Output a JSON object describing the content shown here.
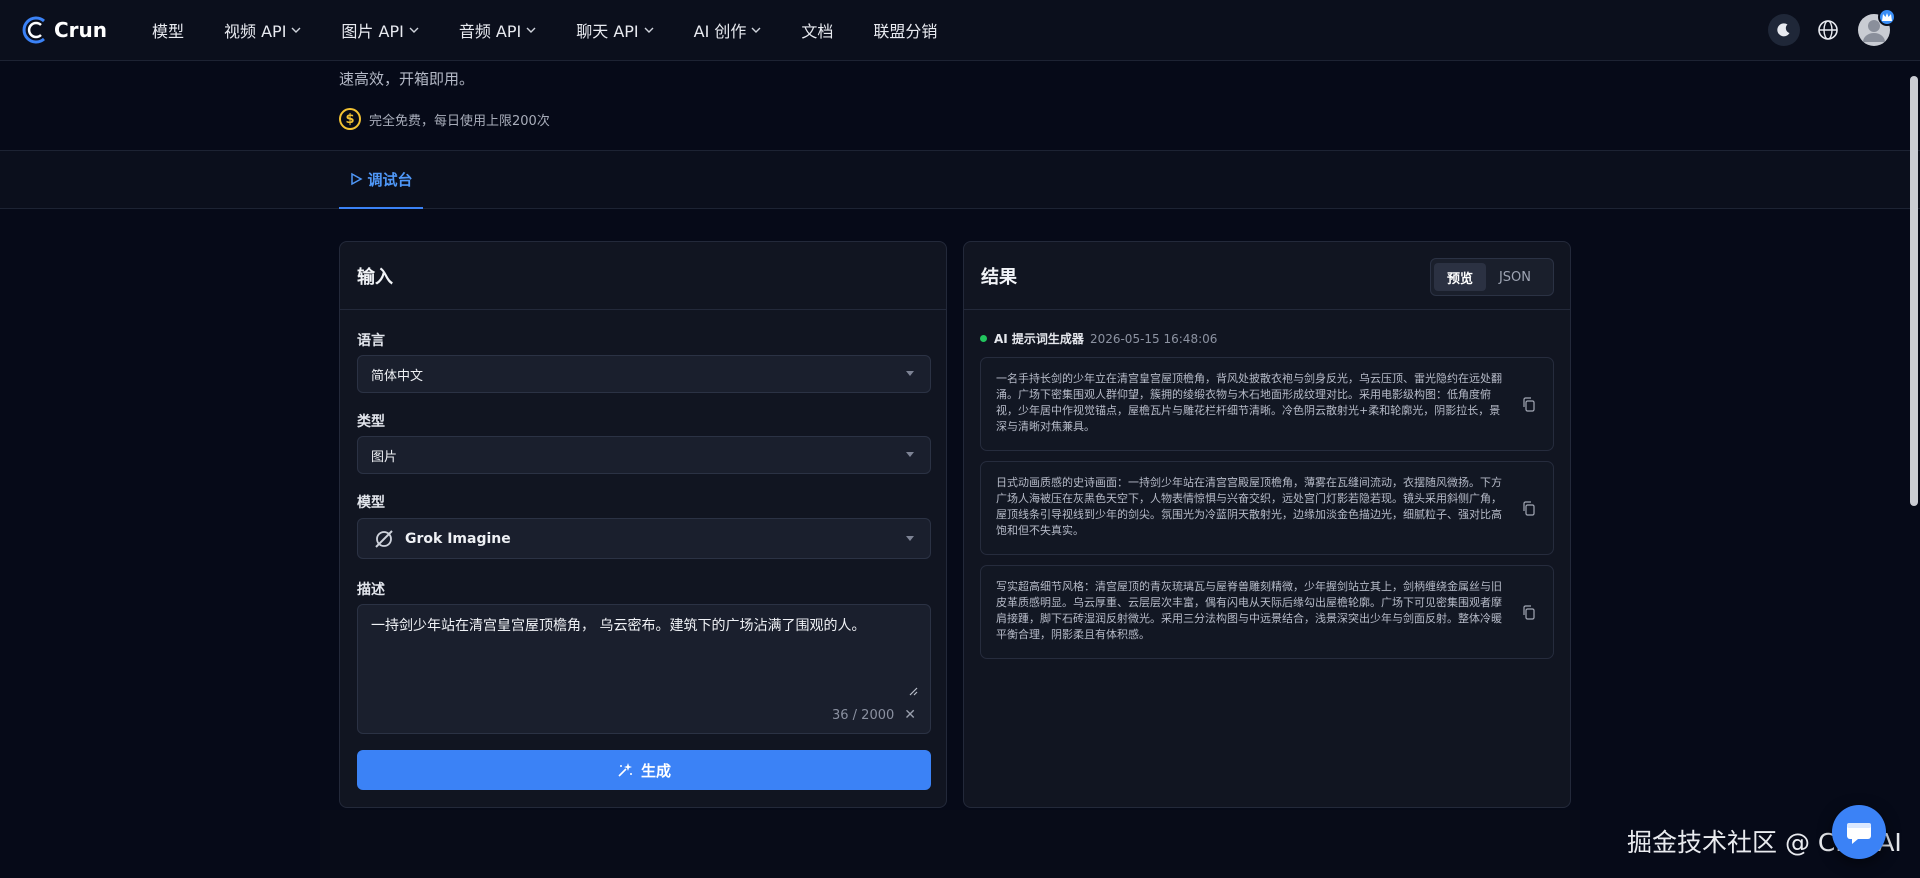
{
  "nav": {
    "logo_text": "Crun",
    "items": [
      {
        "label": "模型",
        "dropdown": false
      },
      {
        "label": "视频 API",
        "dropdown": true
      },
      {
        "label": "图片 API",
        "dropdown": true
      },
      {
        "label": "音频 API",
        "dropdown": true
      },
      {
        "label": "聊天 API",
        "dropdown": true
      },
      {
        "label": "AI 创作",
        "dropdown": true
      },
      {
        "label": "文档",
        "dropdown": false
      },
      {
        "label": "联盟分销",
        "dropdown": false
      }
    ],
    "icons": [
      "moon-icon",
      "globe-icon",
      "user-avatar"
    ]
  },
  "hero": {
    "description": "速高效，开箱即用。",
    "free_note": "完全免费，每日使用上限200次",
    "coin_symbol": "$"
  },
  "tabs": [
    {
      "label": "调试台",
      "active": true
    }
  ],
  "input_panel": {
    "title": "输入",
    "language_label": "语言",
    "language_value": "简体中文",
    "type_label": "类型",
    "type_value": "图片",
    "model_label": "模型",
    "model_value": "Grok Imagine",
    "desc_label": "描述",
    "desc_value": "一持剑少年站在清宫皇宫屋顶檐角， 乌云密布。建筑下的广场沾满了围观的人。",
    "counter": "36 / 2000",
    "clear_symbol": "✕",
    "generate_label": "生成"
  },
  "result_panel": {
    "title": "结果",
    "view_preview": "预览",
    "view_json": "JSON",
    "generator_name": "AI 提示词生成器",
    "timestamp": "2026-05-15 16:48:06",
    "results": [
      {
        "text": "一名手持长剑的少年立在清宫皇宫屋顶檐角，背风处披散衣袍与剑身反光，乌云压顶、雷光隐约在远处翻涌。广场下密集围观人群仰望，簇拥的绫缎衣物与木石地面形成纹理对比。采用电影级构图：低角度俯视，少年居中作视觉锚点，屋檐瓦片与雕花栏杆细节清晰。冷色阴云散射光+柔和轮廓光，阴影拉长，景深与清晰对焦兼具。"
      },
      {
        "text": "日式动画质感的史诗画面：一持剑少年站在清宫宫殿屋顶檐角，薄雾在瓦缝间流动，衣摆随风微扬。下方广场人海被压在灰黑色天空下，人物表情惊惧与兴奋交织，远处宫门灯影若隐若现。镜头采用斜侧广角，屋顶线条引导视线到少年的剑尖。氛围光为冷蓝阴天散射光，边缘加淡金色描边光，细腻粒子、强对比高饱和但不失真实。"
      },
      {
        "text": "写实超高细节风格：清宫屋顶的青灰琉璃瓦与屋脊兽雕刻精微，少年握剑站立其上，剑柄缠绕金属丝与旧皮革质感明显。乌云厚重、云层层次丰富，偶有闪电从天际后缘勾出屋檐轮廓。广场下可见密集围观者摩肩接踵，脚下石砖湿润反射微光。采用三分法构图与中远景结合，浅景深突出少年与剑面反射。整体冷暖平衡合理，阴影柔且有体积感。"
      }
    ]
  },
  "watermark": "掘金技术社区 @ CrunAI",
  "colors": {
    "accent": "#3b82f6",
    "background": "#060a18",
    "panel": "#111521",
    "status_green": "#22c55e",
    "coin_gold": "#f2c233"
  }
}
